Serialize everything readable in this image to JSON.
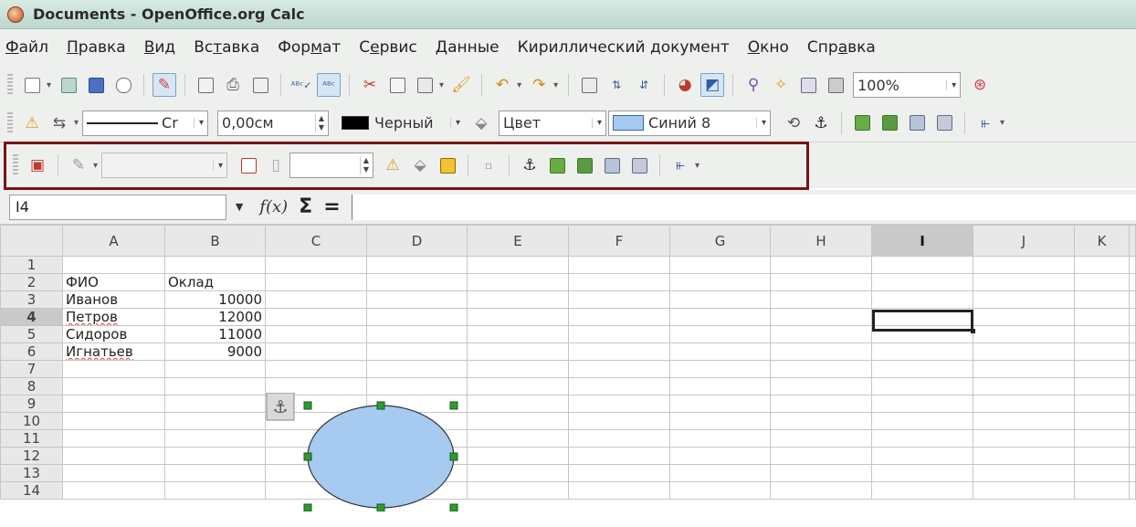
{
  "window": {
    "title": "Documents - OpenOffice.org Calc"
  },
  "menu": [
    {
      "label": "Файл",
      "u": "Ф",
      "rest": "айл"
    },
    {
      "label": "Правка",
      "u": "П",
      "rest": "равка"
    },
    {
      "label": "Вид",
      "u": "В",
      "rest": "ид"
    },
    {
      "label": "Вставка",
      "pre": "Вс",
      "u": "т",
      "rest": "авка"
    },
    {
      "label": "Формат",
      "pre": "Фор",
      "u": "м",
      "rest": "ат"
    },
    {
      "label": "Сервис",
      "pre": "С",
      "u": "е",
      "rest": "рвис"
    },
    {
      "label": "Данные",
      "u": "Д",
      "rest": "анные"
    },
    {
      "label": "Кириллический документ",
      "u": "",
      "rest": "Кириллический документ"
    },
    {
      "label": "Окно",
      "u": "О",
      "rest": "кно"
    },
    {
      "label": "Справка",
      "pre": "Спр",
      "u": "а",
      "rest": "вка"
    }
  ],
  "toolbar": {
    "zoom": "100%",
    "line_style_label": "Cr",
    "line_width": "0,00см",
    "line_color": "Черный",
    "line_color_hex": "#000000",
    "area_style": "Цвет",
    "area_fill": "Синий 8",
    "area_fill_hex": "#a6caf0",
    "drawing_style": "",
    "drawing_value": ""
  },
  "formula_bar": {
    "cell_ref": "I4",
    "fx": "f(x)",
    "sigma": "Σ",
    "equals": "=",
    "content": ""
  },
  "sheet": {
    "columns": [
      "A",
      "B",
      "C",
      "D",
      "E",
      "F",
      "G",
      "H",
      "I",
      "J",
      "K"
    ],
    "selected_column": "I",
    "selected_row": "4",
    "rows": [
      {
        "n": "1",
        "a": "",
        "b": ""
      },
      {
        "n": "2",
        "a": "ФИО",
        "b": "Оклад"
      },
      {
        "n": "3",
        "a": "Иванов",
        "b": "10000"
      },
      {
        "n": "4",
        "a": "Петров",
        "b": "12000"
      },
      {
        "n": "5",
        "a": "Сидоров",
        "b": "11000"
      },
      {
        "n": "6",
        "a": "Игнатьев",
        "b": "9000"
      },
      {
        "n": "7",
        "a": "",
        "b": ""
      },
      {
        "n": "8",
        "a": "",
        "b": ""
      },
      {
        "n": "9",
        "a": "",
        "b": ""
      },
      {
        "n": "10",
        "a": "",
        "b": ""
      },
      {
        "n": "11",
        "a": "",
        "b": ""
      },
      {
        "n": "12",
        "a": "",
        "b": ""
      },
      {
        "n": "13",
        "a": "",
        "b": ""
      },
      {
        "n": "14",
        "a": "",
        "b": ""
      }
    ]
  },
  "shape": {
    "type": "ellipse",
    "fill": "#a6caf0",
    "stroke": "#333333",
    "handle_color": "#2e9b2e",
    "anchor_icon": "anchor-icon"
  }
}
